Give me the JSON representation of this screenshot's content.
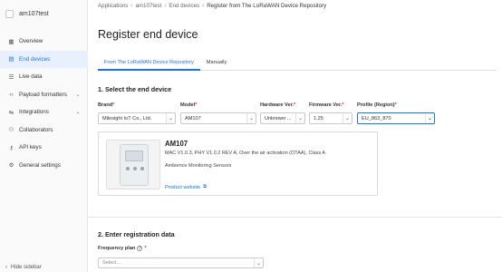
{
  "app": {
    "name": "am107test"
  },
  "sidebar": {
    "items": [
      {
        "label": "Overview",
        "icon": "grid-icon",
        "glyph": "▦"
      },
      {
        "label": "End devices",
        "icon": "devices-icon",
        "glyph": "▤"
      },
      {
        "label": "Live data",
        "icon": "list-icon",
        "glyph": "☰"
      },
      {
        "label": "Payload formatters",
        "icon": "code-icon",
        "glyph": "‹›"
      },
      {
        "label": "Integrations",
        "icon": "integrations-icon",
        "glyph": "⇆"
      },
      {
        "label": "Collaborators",
        "icon": "people-icon",
        "glyph": "⚇"
      },
      {
        "label": "API keys",
        "icon": "key-icon",
        "glyph": "⚷"
      },
      {
        "label": "General settings",
        "icon": "gear-icon",
        "glyph": "⚙"
      }
    ],
    "hide_label": "Hide sidebar"
  },
  "breadcrumb": [
    "Applications",
    "am107test",
    "End devices",
    "Register from The LoRaWAN Device Repository"
  ],
  "page_title": "Register end device",
  "tabs": [
    "From The LoRaWAN Device Repository",
    "Manually"
  ],
  "step1": {
    "title": "1. Select the end device",
    "fields": {
      "brand": {
        "label": "Brand",
        "value": "Milesight IoT Co., Ltd."
      },
      "model": {
        "label": "Model",
        "value": "AM107"
      },
      "hardware": {
        "label": "Hardware Ver.",
        "value": "Unknown ..."
      },
      "firmware": {
        "label": "Firmware Ver.",
        "value": "1.25"
      },
      "profile": {
        "label": "Profile (Region)",
        "value": "EU_863_870"
      }
    },
    "device": {
      "name": "AM107",
      "description": "MAC V1.0.3, PHY V1.0.2 REV A, Over the air activation (OTAA), Class A",
      "sensors": "Ambience Monitoring Sensors",
      "link": "Product website"
    }
  },
  "step2": {
    "title": "2. Enter registration data",
    "frequency_label": "Frequency plan",
    "frequency_placeholder": "Select..."
  },
  "colors": {
    "accent": "#1a73e8",
    "required": "#d93025"
  }
}
